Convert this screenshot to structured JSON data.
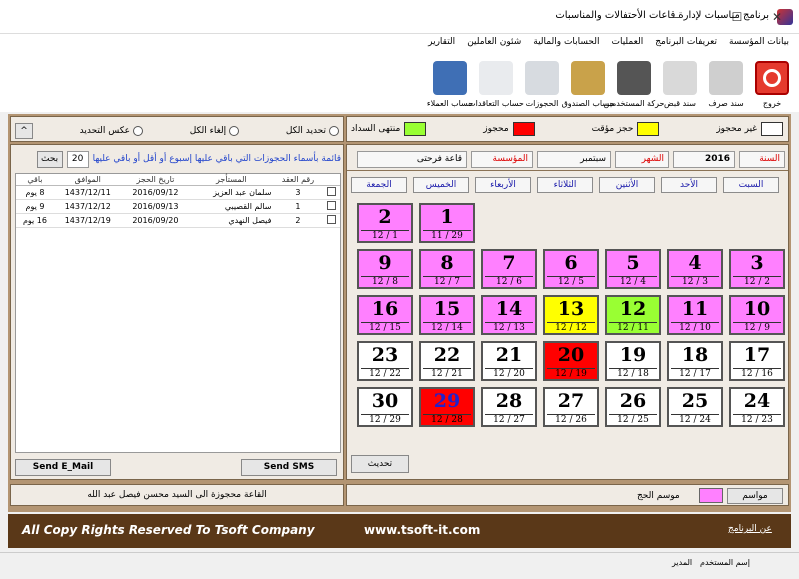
{
  "window": {
    "title": "برنامج مناسبات لإدارة قاعات الأحتفالات والمناسبات",
    "min": "—",
    "max": "☐",
    "close": "✕"
  },
  "menu": [
    "بيانات المؤسسة",
    "تعريفات البرنامج",
    "العمليات",
    "الحسابات والمالية",
    "شئون العاملين",
    "التقارير"
  ],
  "toolbar": [
    {
      "name": "exit-button",
      "label": "خروج",
      "color": "#e53a2e",
      "icon": "power-icon"
    },
    {
      "name": "payment-voucher-button",
      "label": "سند صرف",
      "color": "#cfcfcf",
      "icon": "voucher-icon"
    },
    {
      "name": "receipt-voucher-button",
      "label": "سند قبض",
      "color": "#d9d9d9",
      "icon": "receipt-icon"
    },
    {
      "name": "user-activity-button",
      "label": "حركة المستخدمين",
      "color": "#555",
      "icon": "binoculars-icon"
    },
    {
      "name": "cashbox-button",
      "label": "حساب الصندوق",
      "color": "#c9a24a",
      "icon": "safe-icon"
    },
    {
      "name": "bookings-button",
      "label": "الحجوزات",
      "color": "#d7dbe0",
      "icon": "magnifier-icon"
    },
    {
      "name": "contracts-button",
      "label": "حساب التعاقدات",
      "color": "#e9ebee",
      "icon": "document-icon"
    },
    {
      "name": "customers-button",
      "label": "حساب العملاء",
      "color": "#3f6fb5",
      "icon": "user-icon"
    }
  ],
  "legend": {
    "unreserved": "غير محجوز",
    "temp": "حجز مؤقت",
    "reserved": "محجوز",
    "paid": "منتهى السداد",
    "c_unreserved": "#ffffff",
    "c_temp": "#ffff00",
    "c_reserved": "#ff0000",
    "c_paid": "#99ff33"
  },
  "select_opts": {
    "select_all": "تحديد الكل",
    "cancel_all": "إلغاء الكل",
    "invert": "عكس التحديد",
    "collapse": "^"
  },
  "filters": {
    "year_label": "السنة",
    "year": "2016",
    "month_label": "الشهر",
    "month": "سبتمبر",
    "org_label": "المؤسسة",
    "hall": "قاعة فرحتى"
  },
  "weekdays": [
    "السبت",
    "الأحد",
    "الأثنين",
    "الثلاثاء",
    "الأربعاء",
    "الخميس",
    "الجمعة"
  ],
  "calendar": [
    [
      {
        "d": "3",
        "s": "12 / 2",
        "c": "#ff80ff"
      },
      {
        "d": "4",
        "s": "12 / 3",
        "c": "#ff80ff"
      },
      {
        "d": "5",
        "s": "12 / 4",
        "c": "#ff80ff"
      },
      {
        "d": "6",
        "s": "12 / 5",
        "c": "#ff80ff"
      },
      {
        "d": "7",
        "s": "12 / 6",
        "c": "#ff80ff"
      },
      {
        "d": "8",
        "s": "12 / 7",
        "c": "#ff80ff"
      },
      {
        "d": "9",
        "s": "12 / 8",
        "c": "#ff80ff"
      }
    ],
    [
      {
        "d": "10",
        "s": "12 / 9",
        "c": "#ff80ff"
      },
      {
        "d": "11",
        "s": "12 / 10",
        "c": "#ff80ff"
      },
      {
        "d": "12",
        "s": "12 / 11",
        "c": "#99ff33"
      },
      {
        "d": "13",
        "s": "12 / 12",
        "c": "#ffff00"
      },
      {
        "d": "14",
        "s": "12 / 13",
        "c": "#ff80ff"
      },
      {
        "d": "15",
        "s": "12 / 14",
        "c": "#ff80ff"
      },
      {
        "d": "16",
        "s": "12 / 15",
        "c": "#ff80ff"
      }
    ],
    [
      {
        "d": "17",
        "s": "12 / 16",
        "c": "#ffffff"
      },
      {
        "d": "18",
        "s": "12 / 17",
        "c": "#ffffff"
      },
      {
        "d": "19",
        "s": "12 / 18",
        "c": "#ffffff"
      },
      {
        "d": "20",
        "s": "12 / 19",
        "c": "#ff0000"
      },
      {
        "d": "21",
        "s": "12 / 20",
        "c": "#ffffff"
      },
      {
        "d": "22",
        "s": "12 / 21",
        "c": "#ffffff"
      },
      {
        "d": "23",
        "s": "12 / 22",
        "c": "#ffffff"
      }
    ],
    [
      {
        "d": "24",
        "s": "12 / 23",
        "c": "#ffffff"
      },
      {
        "d": "25",
        "s": "12 / 24",
        "c": "#ffffff"
      },
      {
        "d": "26",
        "s": "12 / 25",
        "c": "#ffffff"
      },
      {
        "d": "27",
        "s": "12 / 26",
        "c": "#ffffff"
      },
      {
        "d": "28",
        "s": "12 / 27",
        "c": "#ffffff"
      },
      {
        "d": "29",
        "s": "12 / 28",
        "c": "#ff0000",
        "t": "#2222cc"
      },
      {
        "d": "30",
        "s": "12 / 29",
        "c": "#ffffff"
      }
    ]
  ],
  "first_row": [
    {
      "d": "1",
      "s": "11 / 29",
      "c": "#ff80ff",
      "col": 5
    },
    {
      "d": "2",
      "s": "12 / 1",
      "c": "#ff80ff",
      "col": 6
    }
  ],
  "refresh": "تحديث",
  "season_btn": "مواسم",
  "season_label": "موسم الحج",
  "season_color": "#ff80ff",
  "reminder": {
    "text": "قائمة بأسماء الحجوزات التي باقي عليها إسبوع أو أقل أو باقي عليها",
    "days": "20",
    "search": "بحث"
  },
  "table": {
    "headers": [
      "رقم العقد",
      "المستأجر",
      "تاريخ الحجز",
      "الموافق",
      "باقي"
    ],
    "rows": [
      [
        "3",
        "سلمان عبد العزيز",
        "2016/09/12",
        "1437/12/11",
        "8 يوم"
      ],
      [
        "1",
        "سالم القصيبي",
        "2016/09/13",
        "1437/12/12",
        "9 يوم"
      ],
      [
        "2",
        "فيصل النهدي",
        "2016/09/20",
        "1437/12/19",
        "16 يوم"
      ]
    ]
  },
  "send_email": "Send E_Mail",
  "send_sms": "Send SMS",
  "hall_status": "القاعة محجوزة الى السيد محسن فيصل عبد الله",
  "footer": {
    "rights": "All Copy Rights Reserved To Tsoft Company",
    "url": "www.tsoft-it.com",
    "about": "عن البرنامج"
  },
  "status": {
    "user_label": "إسم المستخدم",
    "user": "المدير"
  }
}
